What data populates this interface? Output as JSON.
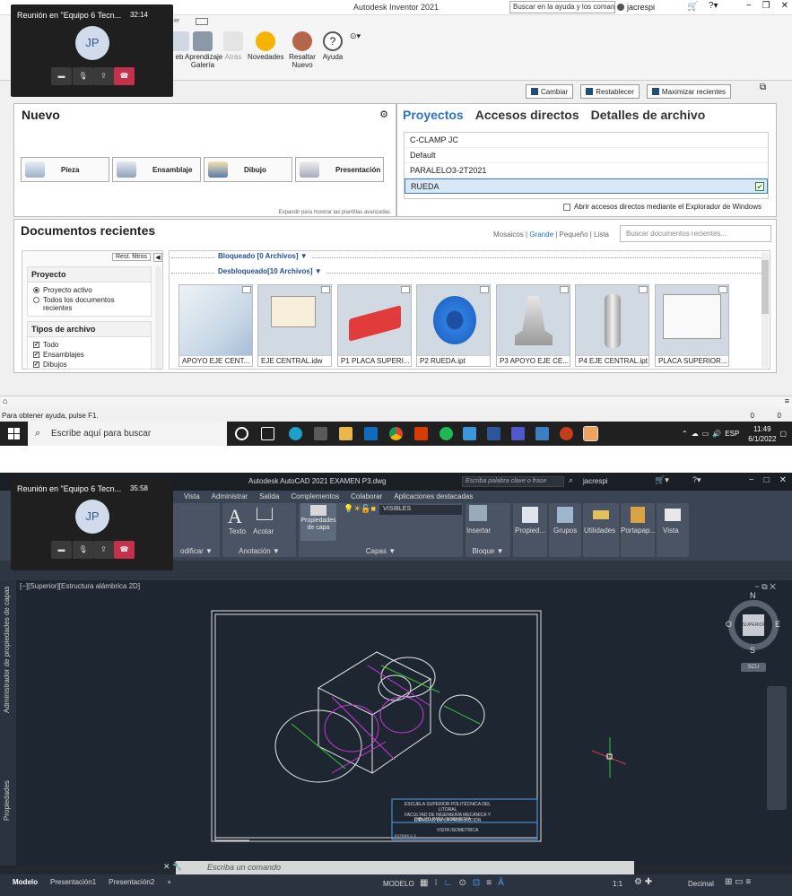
{
  "inventor": {
    "app_title": "Autodesk Inventor 2021",
    "help_search_placeholder": "Buscar en la ayuda y los comandos",
    "user": "jacrespi",
    "ribbon_partial_label": "er",
    "ribbon_buttons": [
      "eb",
      "Aprendizaje Galería",
      "Atrás",
      "Novedades",
      "Resaltar Nuevo",
      "Ayuda"
    ],
    "top_buttons": [
      "Cambiar",
      "Restablecer",
      "Maximizar recientes"
    ],
    "new_panel": {
      "title": "Nuevo",
      "buttons": [
        "Pieza",
        "Ensamblaje",
        "Dibujo",
        "Presentación"
      ],
      "expand_hint": "Expandir para mostrar las plantillas avanzadas"
    },
    "projects_panel": {
      "tabs": [
        "Proyectos",
        "Accesos directos",
        "Detalles de archivo"
      ],
      "items": [
        "C-CLAMP JC",
        "Default",
        "PARALELO3-2T2021",
        "RUEDA"
      ],
      "selected": "RUEDA",
      "explorer_checkbox": "Abrir accesos directos mediante el Explorador de Windows"
    },
    "recent_panel": {
      "title": "Documentos recientes",
      "views": [
        "Mosaicos",
        "Grande",
        "Pequeño",
        "Lista"
      ],
      "active_view": "Grande",
      "search_placeholder": "Buscar documentos recientes...",
      "reset_filters": "Rest. filtros",
      "filter_project_title": "Proyecto",
      "filter_project_options": [
        "Proyecto activo",
        "Todos los documentos recientes"
      ],
      "filter_types_title": "Tipos de archivo",
      "filter_types": [
        "Todo",
        "Ensamblajes",
        "Dibujos"
      ],
      "locked_group": "Bloqueado [0 Archivos] ▼",
      "unlocked_group": "Desbloqueado[10 Archivos] ▼",
      "files": [
        "APOYO EJE CENT...",
        "EJE CENTRAL.idw",
        "P1 PLACA SUPERI...",
        "P2 RUEDA.ipt",
        "P3 APOYO EJE CE...",
        "P4 EJE CENTRAL.ipt",
        "PLACA SUPERIOR..."
      ]
    },
    "status_text": "Para obtener ayuda, pulse F1.",
    "status_counts": [
      "0",
      "0"
    ]
  },
  "taskbar": {
    "search_placeholder": "Escribe aquí para buscar",
    "language": "ESP",
    "time": "11:49",
    "date": "6/1/2022"
  },
  "autocad": {
    "title": "Autodesk AutoCAD 2021   EXAMEN P3.dwg",
    "search_placeholder": "Escriba palabra clave o frase",
    "user": "jacrespi",
    "menu_tabs": [
      "Vista",
      "Administrar",
      "Salida",
      "Complementos",
      "Colaborar",
      "Aplicaciones destacadas"
    ],
    "ribbon_groups": [
      "odificar ▼",
      "Anotación ▼",
      "Capas ▼",
      "Bloque ▼"
    ],
    "ribbon_buttons": [
      "Texto",
      "Acotar",
      "Propiedades de capa",
      "Insertar",
      "Propied...",
      "Grupos",
      "Utilidades",
      "Portapap...",
      "Vista"
    ],
    "layer_name": "VISIBLES",
    "viewport_label": "[−][Superior][Estructura alámbrica 2D]",
    "side_panels": [
      "Administrador de propiedades de capas",
      "Propiedades"
    ],
    "viewcube": {
      "n": "N",
      "s": "S",
      "e": "E",
      "o": "O",
      "face": "SUPERIOR",
      "ucs": "SCU"
    },
    "title_block": {
      "school": "ESCUELA SUPERIOR POLITÉCNICA DEL LITORAL",
      "faculty": "FACULTAD DE INGENIERÍA MECÁNICA Y CIENCIAS DE LA PRODUCCIÓN",
      "course": "DIBUJO PARA INGENIERÍA",
      "view": "VISTA ISOMETRICA",
      "sheet": "EXTENS C-3"
    },
    "command_placeholder": "Escriba un comando",
    "layout_tabs": [
      "Modelo",
      "Presentación1",
      "Presentación2",
      "+"
    ],
    "status_items": [
      "MODELO",
      "1:1",
      "Decimal"
    ]
  },
  "teams_calls": [
    {
      "title": "Reunión en \"Equipo 6 Tecn...",
      "timer": "32:14",
      "initials": "JP"
    },
    {
      "title": "Reunión en \"Equipo 6 Tecn...",
      "timer": "35:58",
      "initials": "JP"
    }
  ]
}
